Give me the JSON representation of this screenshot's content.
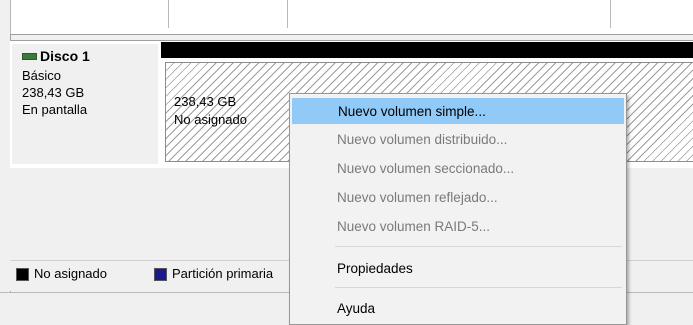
{
  "disk": {
    "name": "Disco 1",
    "type": "Básico",
    "size": "238,43 GB",
    "status": "En pantalla"
  },
  "partition": {
    "size": "238,43 GB",
    "state": "No asignado"
  },
  "legend": {
    "items": [
      {
        "label": "No asignado",
        "color": "#000000"
      },
      {
        "label": "Partición primaria",
        "color": "#1a1a8c"
      }
    ]
  },
  "context_menu": {
    "items": [
      {
        "label": "Nuevo volumen simple...",
        "enabled": true,
        "highlighted": true
      },
      {
        "label": "Nuevo volumen distribuido...",
        "enabled": false
      },
      {
        "label": "Nuevo volumen seccionado...",
        "enabled": false
      },
      {
        "label": "Nuevo volumen reflejado...",
        "enabled": false
      },
      {
        "label": "Nuevo volumen RAID-5...",
        "enabled": false
      },
      {
        "label": "Propiedades",
        "enabled": true
      },
      {
        "label": "Ayuda",
        "enabled": true
      }
    ]
  }
}
